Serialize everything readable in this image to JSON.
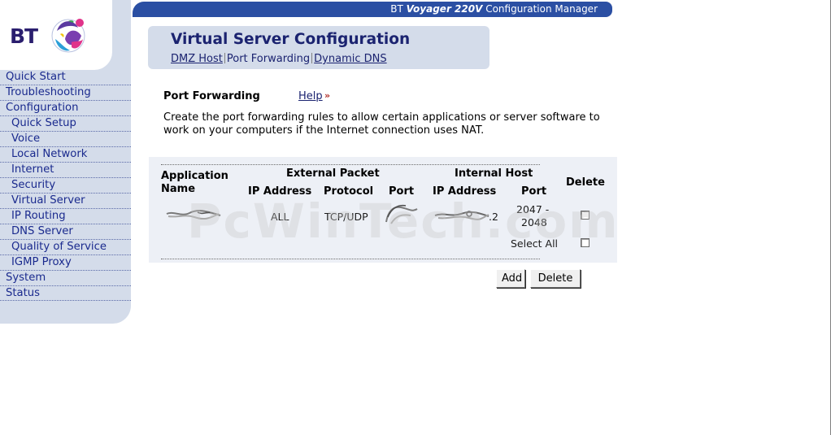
{
  "brand": {
    "logo_text": "BT",
    "primary": "#2b4fa3",
    "sidebar_bg": "#d4dcea",
    "title_color": "#1b2370"
  },
  "header": {
    "title_prefix": "BT ",
    "title_model": "Voyager 220V",
    "title_suffix": " Configuration Manager"
  },
  "sidebar": {
    "items": [
      {
        "label": "Quick Start",
        "level": 0
      },
      {
        "label": "Troubleshooting",
        "level": 0
      },
      {
        "label": "Configuration",
        "level": 0
      },
      {
        "label": "Quick Setup",
        "level": 1
      },
      {
        "label": "Voice",
        "level": 1
      },
      {
        "label": "Local Network",
        "level": 1
      },
      {
        "label": "Internet",
        "level": 1
      },
      {
        "label": "Security",
        "level": 1
      },
      {
        "label": "Virtual Server",
        "level": 1
      },
      {
        "label": "IP Routing",
        "level": 1
      },
      {
        "label": "DNS Server",
        "level": 1
      },
      {
        "label": "Quality of Service",
        "level": 1
      },
      {
        "label": "IGMP Proxy",
        "level": 1
      },
      {
        "label": "System",
        "level": 0
      },
      {
        "label": "Status",
        "level": 0
      }
    ]
  },
  "page": {
    "title": "Virtual Server Configuration",
    "tabs": [
      {
        "label": "DMZ Host",
        "link": true
      },
      {
        "label": "Port Forwarding",
        "link": false
      },
      {
        "label": "Dynamic DNS",
        "link": true
      }
    ]
  },
  "section": {
    "title": "Port Forwarding",
    "help_label": "Help",
    "help_icon": "double-chevron-right-icon",
    "description": "Create the port forwarding rules to allow certain applications or server software to work on your computers if the Internet connection uses NAT."
  },
  "table": {
    "headers": {
      "application_name": [
        "Application",
        "Name"
      ],
      "external_packet": "External Packet",
      "ip_address": "IP Address",
      "protocol": "Protocol",
      "port": "Port",
      "internal_host": "Internal Host",
      "internal_ip_address": "IP Address",
      "internal_port": "Port",
      "delete": "Delete"
    },
    "rows": [
      {
        "application_name": "",
        "external_ip": "ALL",
        "protocol": "TCP/UDP",
        "external_port": "",
        "internal_ip_visible": ".2",
        "internal_port_lines": [
          "2047 -",
          "2048"
        ],
        "delete_checked": false
      }
    ],
    "select_all_label": "Select All",
    "select_all_checked": false
  },
  "buttons": {
    "add": "Add",
    "delete": "Delete"
  },
  "watermark": "PcWinTech.com"
}
